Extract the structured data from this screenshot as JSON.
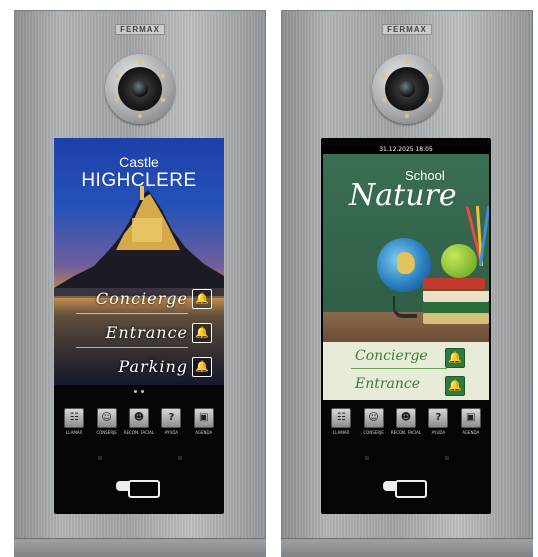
{
  "panels": {
    "left": {
      "brand": "FERMAX",
      "screen": {
        "line1": "Castle",
        "line2": "HIGHCLERE",
        "rows": [
          {
            "label": "Concierge",
            "icon": "bell-icon"
          },
          {
            "label": "Entrance",
            "icon": "bell-icon"
          },
          {
            "label": "Parking",
            "icon": "bell-icon"
          }
        ]
      },
      "keys": [
        {
          "glyph": "☷",
          "label": "LLAMAR",
          "icon": "keypad-icon"
        },
        {
          "glyph": "☺",
          "label": "CONSERJE",
          "icon": "concierge-icon"
        },
        {
          "glyph": "☻",
          "label": "RECON. FACIAL",
          "icon": "face-recognition-icon"
        },
        {
          "glyph": "?",
          "label": "AYUDA",
          "icon": "help-icon"
        },
        {
          "glyph": "▣",
          "label": "AGENDA",
          "icon": "agenda-icon"
        }
      ]
    },
    "right": {
      "brand": "FERMAX",
      "screen": {
        "datetime": "31.12.2025 18:05",
        "line1": "School",
        "line2": "Nature",
        "rows": [
          {
            "label": "Concierge",
            "icon": "bell-icon"
          },
          {
            "label": "Entrance",
            "icon": "bell-icon"
          }
        ]
      },
      "keys": [
        {
          "glyph": "☷",
          "label": "LLAMAR",
          "icon": "keypad-icon"
        },
        {
          "glyph": "☺",
          "label": "CONSERJE",
          "icon": "concierge-icon"
        },
        {
          "glyph": "☻",
          "label": "RECON. FACIAL",
          "icon": "face-recognition-icon"
        },
        {
          "glyph": "?",
          "label": "AYUDA",
          "icon": "help-icon"
        },
        {
          "glyph": "▣",
          "label": "AGENDA",
          "icon": "agenda-icon"
        }
      ]
    }
  },
  "glyphs": {
    "bell": "🔔"
  },
  "colors": {
    "panel_steel": "#a9acae",
    "accent_green": "#2f7a3a",
    "screen_blue": "#2552b8"
  }
}
